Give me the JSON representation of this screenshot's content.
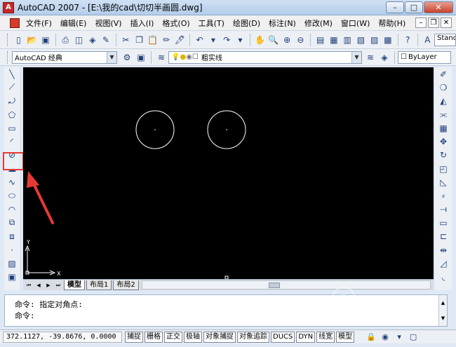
{
  "window": {
    "title": "AutoCAD 2007 - [E:\\我的cad\\切切半画圆.dwg]",
    "min": "–",
    "max": "□",
    "close": "✕"
  },
  "menu": {
    "items": [
      "文件(F)",
      "编辑(E)",
      "视图(V)",
      "插入(I)",
      "格式(O)",
      "工具(T)",
      "绘图(D)",
      "标注(N)",
      "修改(M)",
      "窗口(W)",
      "帮助(H)"
    ],
    "mdi_min": "–",
    "mdi_restore": "❐",
    "mdi_close": "✕"
  },
  "toolbar_standard": {
    "style_box": "Stand",
    "icons": [
      "new-icon",
      "open-icon",
      "save-icon",
      "print-icon",
      "plot-preview-icon",
      "publish-icon",
      "cut-icon",
      "copy-icon",
      "paste-icon",
      "match-properties-icon",
      "brush-icon",
      "undo-icon",
      "redo-icon",
      "pan-icon",
      "zoom-realtime-icon",
      "zoom-window-icon",
      "zoom-previous-icon",
      "properties-icon",
      "design-center-icon",
      "tool-palettes-icon",
      "sheet-set-icon",
      "markup-icon",
      "calculator-icon",
      "help-icon",
      "text-style-icon"
    ]
  },
  "toolbar_workspace": {
    "workspace": "AutoCAD 经典",
    "layer": "粗实线",
    "linetype": "ByLayer"
  },
  "draw_toolbar": [
    "line-icon",
    "construction-line-icon",
    "polyline-icon",
    "polygon-icon",
    "rectangle-icon",
    "arc-icon",
    "circle-icon",
    "revision-cloud-icon",
    "spline-icon",
    "ellipse-icon",
    "ellipse-arc-icon",
    "insert-block-icon",
    "make-block-icon",
    "point-icon",
    "hatch-icon",
    "region-icon"
  ],
  "modify_toolbar": [
    "erase-icon",
    "copy-object-icon",
    "mirror-icon",
    "offset-icon",
    "array-icon",
    "move-icon",
    "rotate-icon",
    "scale-icon",
    "stretch-icon",
    "trim-icon",
    "extend-icon",
    "break-at-point-icon",
    "break-icon",
    "join-icon",
    "chamfer-icon",
    "fillet-icon"
  ],
  "canvas": {
    "background": "#000000",
    "stroke": "#ffffff",
    "ucs_y": "Y",
    "ucs_x": "X"
  },
  "layout_tabs": [
    "模型",
    "布局1",
    "布局2"
  ],
  "command": {
    "line1": "命令: 指定对角点:",
    "line2": "命令:"
  },
  "status": {
    "coords": "372.1127, -39.8676, 0.0000",
    "buttons": [
      "捕捉",
      "栅格",
      "正交",
      "极轴",
      "对象捕捉",
      "对象追踪",
      "DUCS",
      "DYN",
      "线宽",
      "模型"
    ]
  },
  "annotation": {
    "highlight_color": "#e53935"
  }
}
